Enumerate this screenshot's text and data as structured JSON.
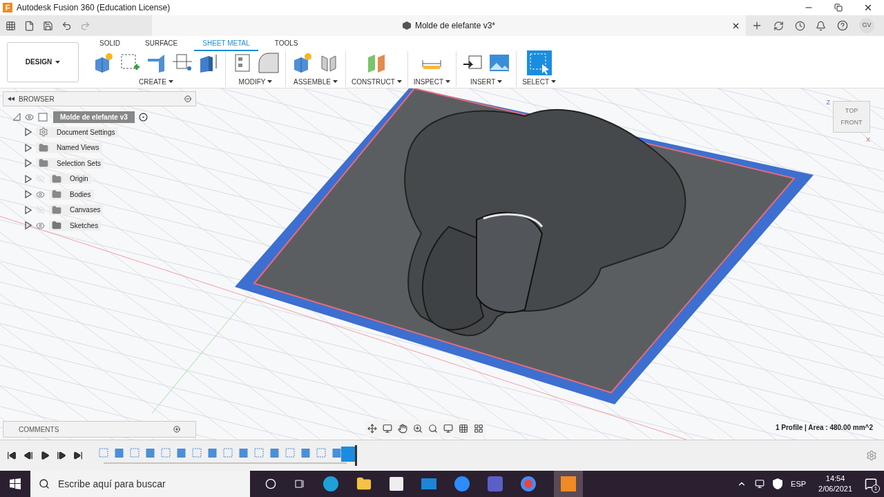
{
  "title_bar": {
    "app_letter": "F",
    "title": "Autodesk Fusion 360 (Education License)"
  },
  "document_tab": {
    "title": "Molde de elefante v3*"
  },
  "user": {
    "initials": "GV"
  },
  "workspace": {
    "label": "DESIGN"
  },
  "tabs": [
    {
      "label": "SOLID",
      "selected": false
    },
    {
      "label": "SURFACE",
      "selected": false
    },
    {
      "label": "SHEET METAL",
      "selected": true
    },
    {
      "label": "TOOLS",
      "selected": false
    }
  ],
  "tool_groups": [
    {
      "label": "CREATE"
    },
    {
      "label": "MODIFY"
    },
    {
      "label": "ASSEMBLE"
    },
    {
      "label": "CONSTRUCT"
    },
    {
      "label": "INSPECT"
    },
    {
      "label": "INSERT"
    },
    {
      "label": "SELECT"
    }
  ],
  "browser": {
    "title": "BROWSER",
    "root": {
      "label": "Molde de elefante v3",
      "visible": true
    },
    "items": [
      {
        "kind": "settings",
        "label": "Document Settings"
      },
      {
        "kind": "folder",
        "label": "Named Views"
      },
      {
        "kind": "folder",
        "label": "Selection Sets"
      },
      {
        "kind": "folder",
        "label": "Origin",
        "visible": false
      },
      {
        "kind": "folder",
        "label": "Bodies",
        "visible": true
      },
      {
        "kind": "folder",
        "label": "Canvases",
        "visible": false
      },
      {
        "kind": "sketches",
        "label": "Sketches",
        "visible": true
      }
    ]
  },
  "view_cube": {
    "top": "TOP",
    "front": "FRONT",
    "axis_z": "Z",
    "axis_x": "X"
  },
  "comments": {
    "title": "COMMENTS"
  },
  "status": "1 Profile | Area : 480.00 mm^2",
  "taskbar": {
    "search_placeholder": "Escribe aquí para buscar",
    "language": "ESP",
    "time": "14:54",
    "date": "2/06/2021",
    "notifications": "1"
  }
}
